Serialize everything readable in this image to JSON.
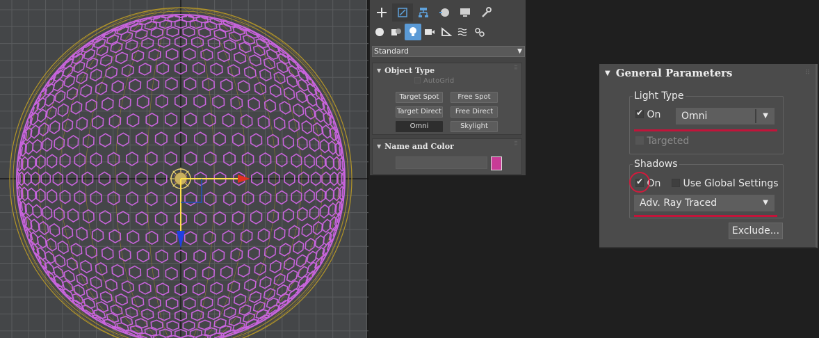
{
  "command_panel": {
    "tabs": [
      "create-icon",
      "modify-icon",
      "hierarchy-icon",
      "motion-icon",
      "display-icon",
      "utilities-icon"
    ],
    "categories": [
      "geometry-icon",
      "shapes-icon",
      "lights-icon",
      "cameras-icon",
      "helpers-icon",
      "spacewarps-icon",
      "systems-icon"
    ],
    "active_category": "lights-icon",
    "type_dropdown": "Standard",
    "object_type": {
      "header": "Object Type",
      "autogrid_label": "AutoGrid",
      "buttons": [
        "Target Spot",
        "Free Spot",
        "Target Direct",
        "Free Direct",
        "Omni",
        "Skylight"
      ],
      "active_button": "Omni"
    },
    "name_and_color": {
      "header": "Name and Color",
      "name_value": "",
      "color": "#c83c96"
    }
  },
  "general_parameters": {
    "title": "General Parameters",
    "light_type": {
      "legend": "Light Type",
      "on_label": "On",
      "on_checked": true,
      "type_value": "Omni",
      "targeted_label": "Targeted",
      "targeted_checked": false
    },
    "shadows": {
      "legend": "Shadows",
      "on_label": "On",
      "on_checked": true,
      "use_global_label": "Use Global Settings",
      "use_global_checked": false,
      "shadow_type": "Adv. Ray Traced"
    },
    "exclude_label": "Exclude..."
  },
  "colors": {
    "viewport_bg": "#444648",
    "geosphere_wire": "#c864dc",
    "light_range": "#b49628",
    "highlight": "#c2143a"
  }
}
